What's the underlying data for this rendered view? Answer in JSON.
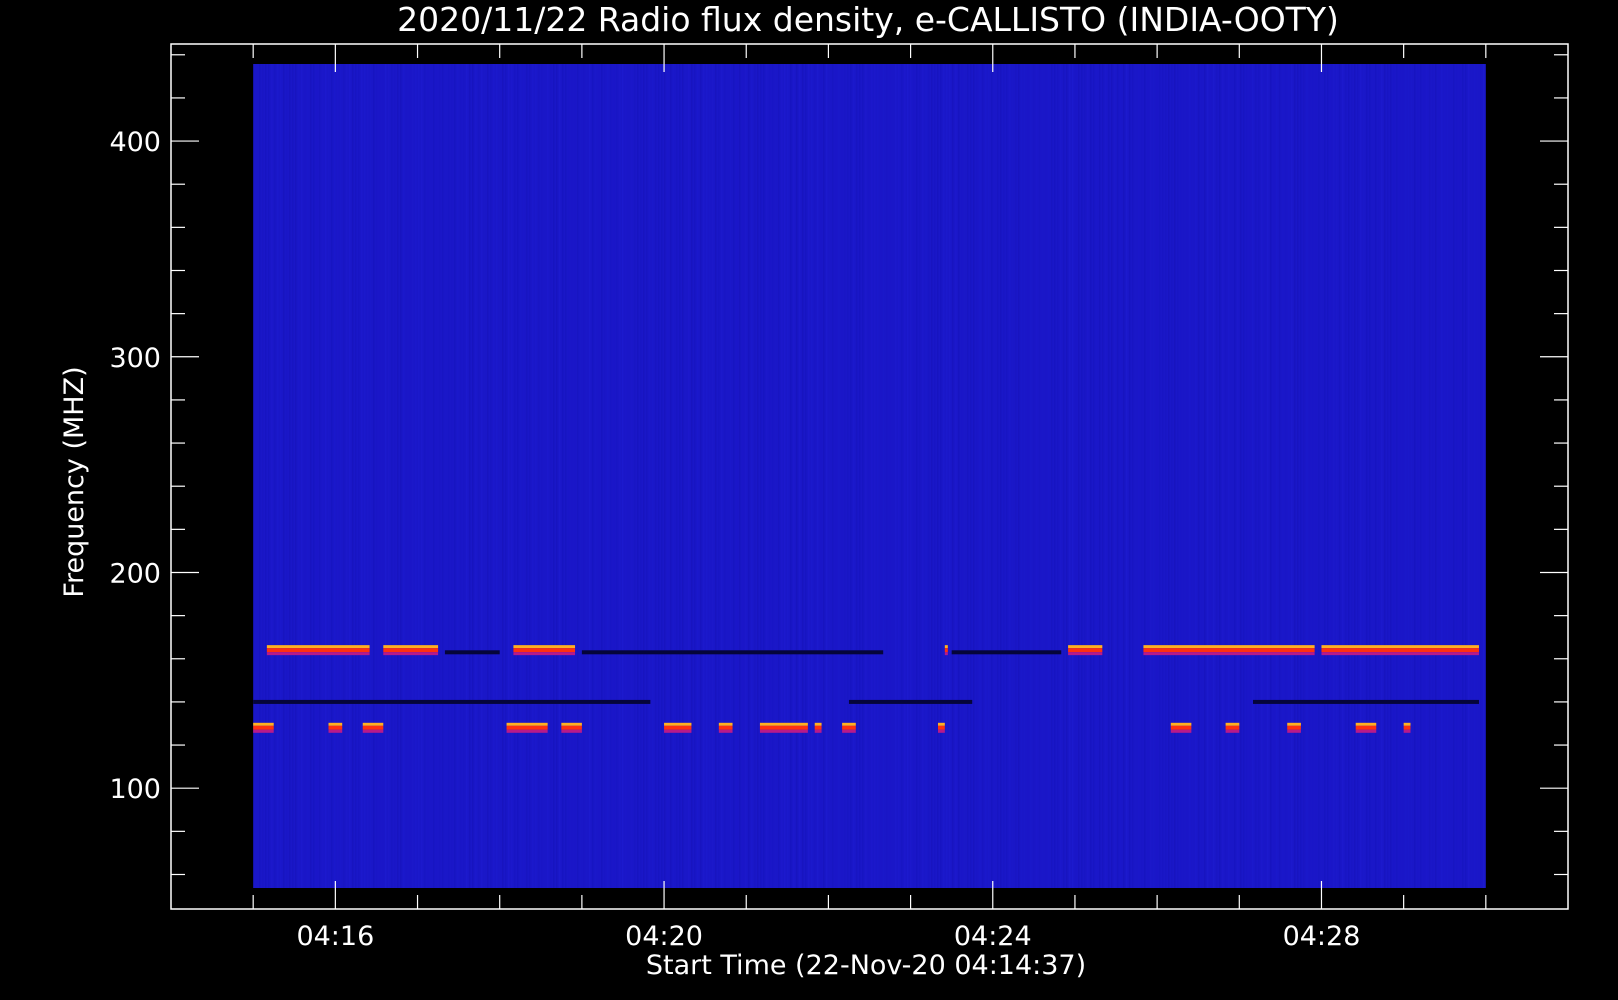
{
  "chart_data": {
    "type": "heatmap",
    "title": "2020/11/22  Radio flux density, e-CALLISTO (INDIA-OOTY)",
    "xlabel": "Start Time (22-Nov-20 04:14:37)",
    "ylabel": "Frequency (MHZ)",
    "x_start": "04:15:00",
    "x_end": "04:30:00",
    "xlim": [
      "04:14:00",
      "04:31:00"
    ],
    "ylim": [
      445,
      44
    ],
    "y_reversed": true,
    "x_ticks": [
      "04:16",
      "04:20",
      "04:24",
      "04:28"
    ],
    "y_ticks": [
      100,
      200,
      300,
      400
    ],
    "colormap": "blue-to-red",
    "background_color": "#1a17c8",
    "emission_bands": [
      {
        "freq_mhz": 128,
        "segments": [
          [
            "04:15:00",
            "04:15:15"
          ],
          [
            "04:15:55",
            "04:16:05"
          ],
          [
            "04:16:20",
            "04:16:35"
          ],
          [
            "04:18:05",
            "04:18:35"
          ],
          [
            "04:18:45",
            "04:19:00"
          ],
          [
            "04:20:00",
            "04:20:20"
          ],
          [
            "04:20:40",
            "04:20:50"
          ],
          [
            "04:21:10",
            "04:21:45"
          ],
          [
            "04:21:50",
            "04:21:55"
          ],
          [
            "04:22:10",
            "04:22:20"
          ],
          [
            "04:23:20",
            "04:23:25"
          ],
          [
            "04:26:10",
            "04:26:25"
          ],
          [
            "04:26:50",
            "04:27:00"
          ],
          [
            "04:27:35",
            "04:27:45"
          ],
          [
            "04:28:25",
            "04:28:40"
          ],
          [
            "04:29:00",
            "04:29:05"
          ]
        ]
      },
      {
        "freq_mhz": 164,
        "segments": [
          [
            "04:15:10",
            "04:16:25"
          ],
          [
            "04:16:35",
            "04:17:15"
          ],
          [
            "04:18:10",
            "04:18:55"
          ],
          [
            "04:23:25",
            "04:23:27"
          ],
          [
            "04:24:55",
            "04:25:20"
          ],
          [
            "04:25:50",
            "04:27:55"
          ],
          [
            "04:28:00",
            "04:29:55"
          ]
        ]
      }
    ],
    "dark_bands": [
      {
        "freq_mhz": 140,
        "segments": [
          [
            "04:15:00",
            "04:19:50"
          ],
          [
            "04:22:15",
            "04:23:45"
          ],
          [
            "04:27:10",
            "04:29:55"
          ]
        ]
      },
      {
        "freq_mhz": 163,
        "segments": [
          [
            "04:17:20",
            "04:18:00"
          ],
          [
            "04:19:00",
            "04:22:40"
          ],
          [
            "04:23:30",
            "04:24:50"
          ]
        ]
      }
    ]
  }
}
